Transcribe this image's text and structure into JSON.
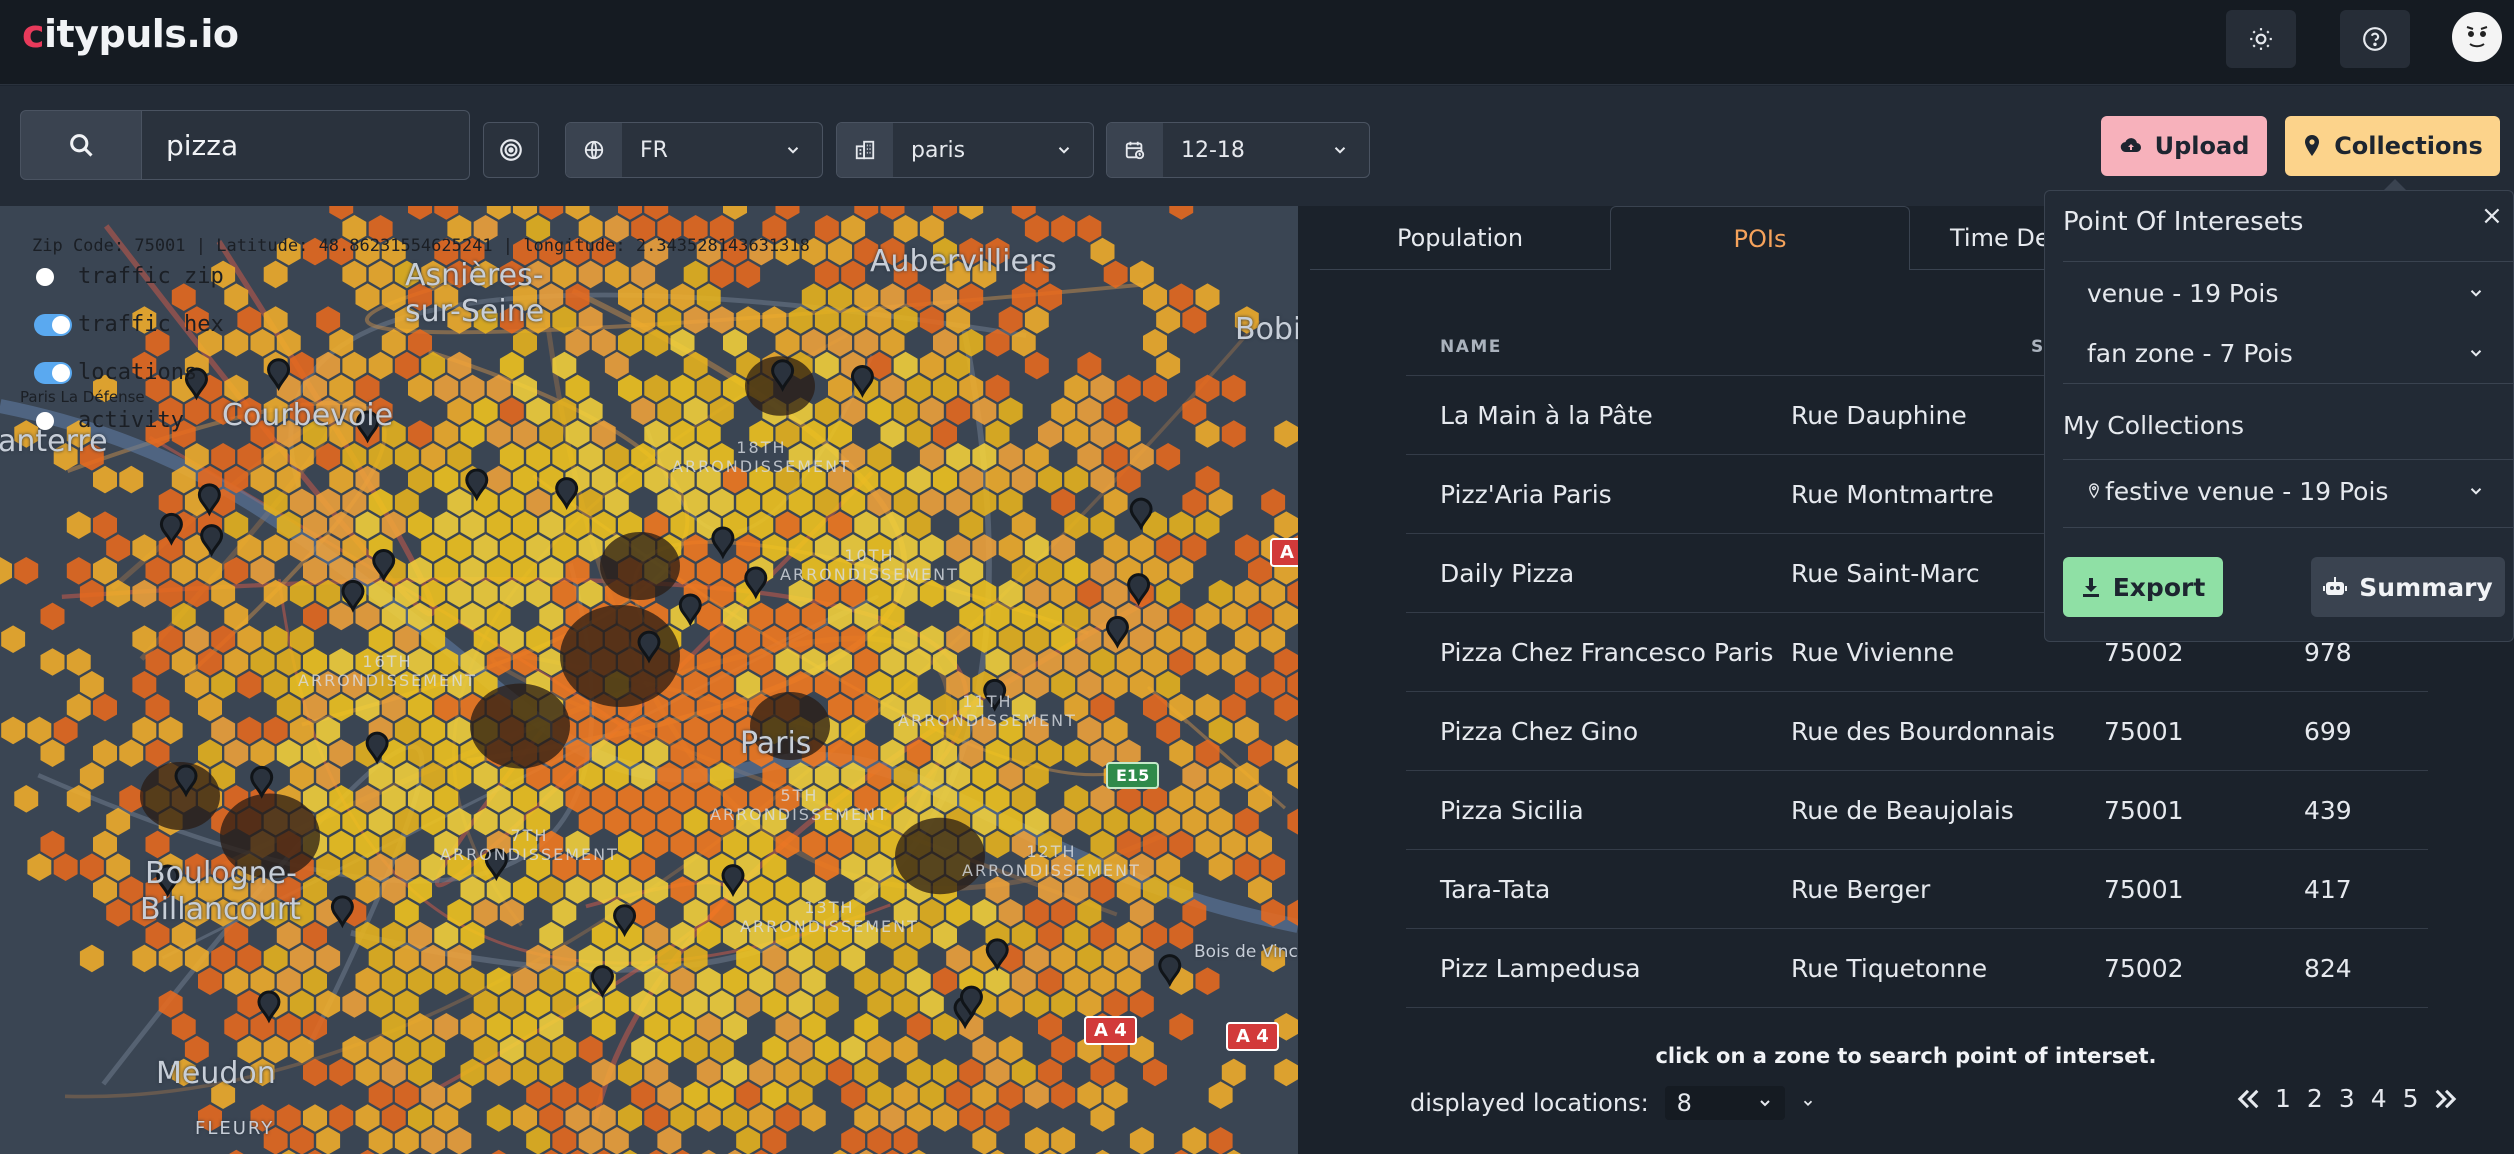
{
  "app": {
    "logo_first": "c",
    "logo_rest": "itypuls.io"
  },
  "header": {
    "theme_icon": "sun-icon",
    "help_icon": "help-icon",
    "avatar_icon": "avatar"
  },
  "search": {
    "value": "pizza",
    "placeholder": ""
  },
  "filters": {
    "country": "FR",
    "city": "paris",
    "time": "12-18"
  },
  "actions": {
    "upload": "Upload",
    "collections": "Collections"
  },
  "map": {
    "info_line": "Zip Code: 75001 | Latitude: 48.86231554625241 | longitude: 2.343528143631318",
    "layers": [
      {
        "label": "traffic zip",
        "on": false
      },
      {
        "label": "traffic hex",
        "on": true
      },
      {
        "label": "locations",
        "on": true
      },
      {
        "label": "activity",
        "on": false
      }
    ],
    "overlay_small": "Paris La Défense",
    "labels": {
      "asnieres": "Asnières-",
      "sur_seine": "sur-Seine",
      "courbevoie": "Courbevoie",
      "aubervilliers": "Aubervilliers",
      "bobigny": "Bobi",
      "boulogne": "Boulogne-",
      "billancourt": "Billancourt",
      "meudon": "Meudon",
      "fleury": "FLEURY",
      "bois": "Bois de Vinc",
      "paris": "Paris",
      "nanterre": "anterre"
    },
    "arrondissements": [
      {
        "id": "a18",
        "text": "18TH\nARRONDISSEMENT"
      },
      {
        "id": "a10",
        "text": "10TH\nARRONDISSEMENT"
      },
      {
        "id": "a16",
        "text": "16TH\nARRONDISSEMENT"
      },
      {
        "id": "a11",
        "text": "11TH\nARRONDISSEMENT"
      },
      {
        "id": "a5",
        "text": "5TH\nARRONDISSEMENT"
      },
      {
        "id": "a7",
        "text": "7TH\nARRONDISSEMENT"
      },
      {
        "id": "a12",
        "text": "12TH\nARRONDISSEMENT"
      },
      {
        "id": "a13",
        "text": "13TH\nARRONDISSEMENT"
      }
    ],
    "roads": {
      "a4_1": "A 4",
      "a4_2": "A 4",
      "e15": "E15",
      "a_top": "A"
    }
  },
  "tabs": [
    {
      "label": "Population",
      "active": false
    },
    {
      "label": "POIs",
      "active": true
    },
    {
      "label": "Time De",
      "active": false
    }
  ],
  "table": {
    "headers": [
      "NAME",
      "STREET",
      "",
      ""
    ],
    "rows": [
      {
        "name": "La Main à la Pâte",
        "street": "Rue Dauphine",
        "zip": "",
        "count": ""
      },
      {
        "name": "Pizz'Aria Paris",
        "street": "Rue Montmartre",
        "zip": "",
        "count": ""
      },
      {
        "name": "Daily Pizza",
        "street": "Rue Saint-Marc",
        "zip": "",
        "count": ""
      },
      {
        "name": "Pizza Chez Francesco Paris",
        "street": "Rue Vivienne",
        "zip": "75002",
        "count": "978"
      },
      {
        "name": "Pizza Chez Gino",
        "street": "Rue des Bourdonnais",
        "zip": "75001",
        "count": "699"
      },
      {
        "name": "Pizza Sicilia",
        "street": "Rue de Beaujolais",
        "zip": "75001",
        "count": "439"
      },
      {
        "name": "Tara-Tata",
        "street": "Rue Berger",
        "zip": "75001",
        "count": "417"
      },
      {
        "name": "Pizz Lampedusa",
        "street": "Rue Tiquetonne",
        "zip": "75002",
        "count": "824"
      }
    ]
  },
  "hint": "click on a zone to search point of interset.",
  "pagination": {
    "displayed_label": "displayed locations:",
    "page_size": "8",
    "pages": [
      "1",
      "2",
      "3",
      "4",
      "5"
    ]
  },
  "collections_popover": {
    "title": "Point Of Interesets",
    "close": "×",
    "poi_sets": [
      "venue - 19 Pois",
      "fan zone - 7 Pois"
    ],
    "my_collections_title": "My Collections",
    "my_collections": [
      "festive venue - 19 Pois"
    ],
    "export": "Export",
    "summary": "Summary"
  },
  "colors": {
    "accent_orange": "#f5a25b",
    "upload_bg": "#f7b1bb",
    "collections_bg": "#fcd38b",
    "export_bg": "#8fe0a5",
    "logo_c": "#e83a5b"
  }
}
